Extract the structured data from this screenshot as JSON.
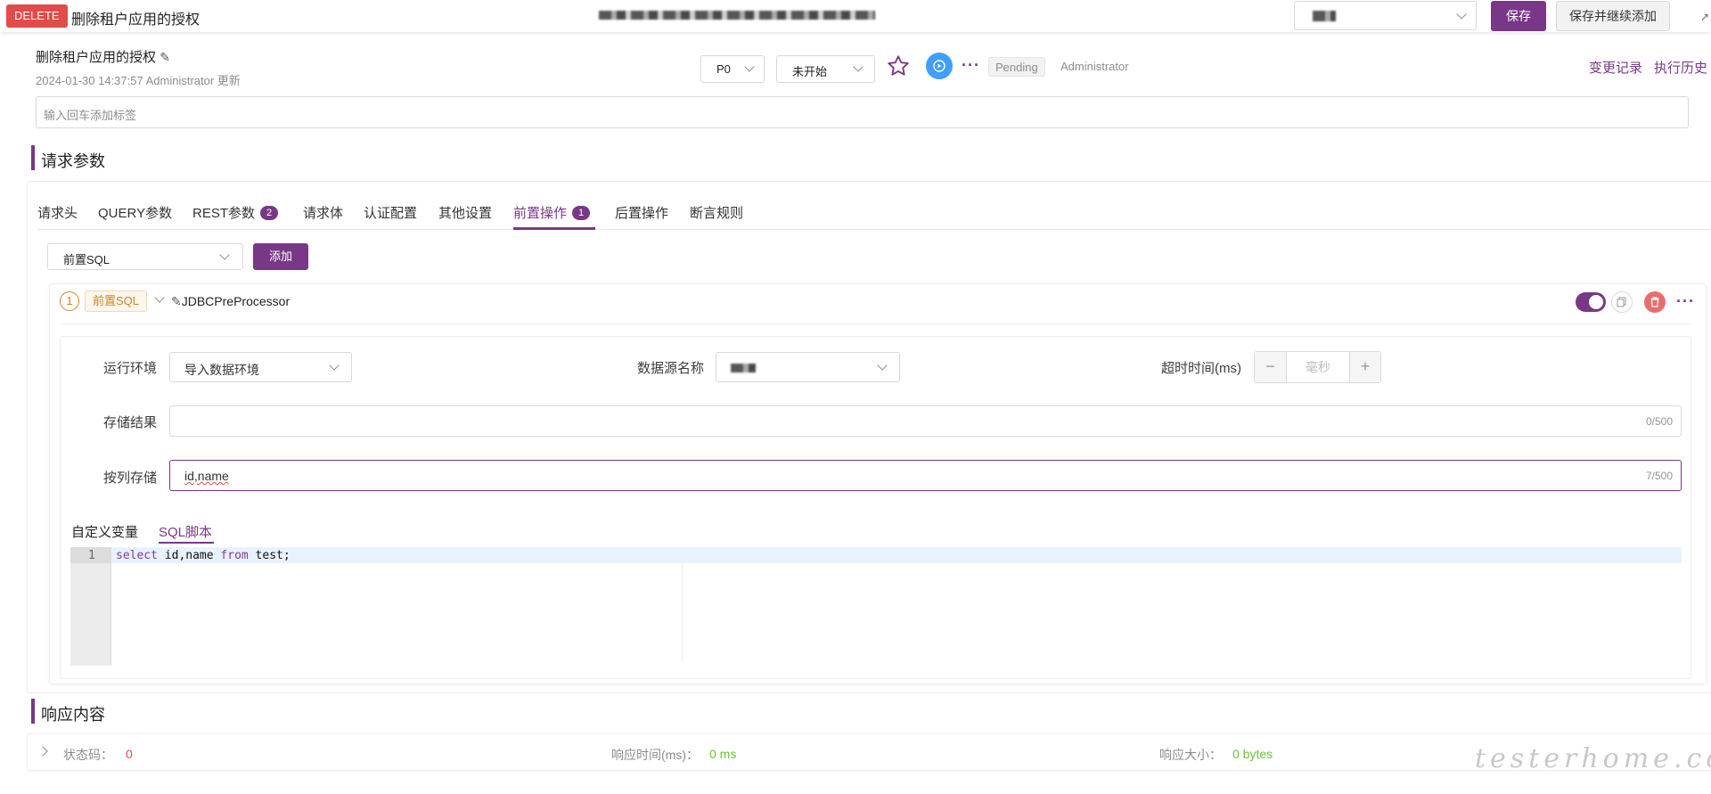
{
  "top": {
    "method": "DELETE",
    "title": "删除租户应用的授权",
    "save_label": "保存",
    "save_continue_label": "保存并继续添加"
  },
  "header": {
    "name": "删除租户应用的授权",
    "updated": "2024-01-30 14:37:57 Administrator 更新",
    "priority": "P0",
    "status": "未开始",
    "state_badge": "Pending",
    "user": "Administrator",
    "changelog_link": "变更记录",
    "history_link": "执行历史",
    "tag_placeholder": "输入回车添加标签"
  },
  "request": {
    "title": "请求参数",
    "tabs": [
      {
        "label": "请求头"
      },
      {
        "label": "QUERY参数"
      },
      {
        "label": "REST参数",
        "badge": "2"
      },
      {
        "label": "请求体"
      },
      {
        "label": "认证配置"
      },
      {
        "label": "其他设置"
      },
      {
        "label": "前置操作",
        "badge": "1"
      },
      {
        "label": "后置操作"
      },
      {
        "label": "断言规则"
      }
    ],
    "type_select": "前置SQL",
    "add_label": "添加"
  },
  "processor": {
    "index": "1",
    "type_tag": "前置SQL",
    "name": "JDBCPreProcessor",
    "env_label": "运行环境",
    "env_value": "导入数据环境",
    "datasource_label": "数据源名称",
    "timeout_label": "超时时间(ms)",
    "timeout_placeholder": "毫秒",
    "store_result_label": "存储结果",
    "store_result_count": "0/500",
    "store_by_column_label": "按列存储",
    "store_by_column_value": "id,name",
    "store_by_column_count": "7/500",
    "subtab_vars": "自定义变量",
    "subtab_sql": "SQL脚本",
    "editor_line": "1",
    "sql_kw1": "select",
    "sql_mid": " id,name ",
    "sql_kw2": "from",
    "sql_end": " test;"
  },
  "response": {
    "title": "响应内容",
    "status_label": "状态码：",
    "status_value": "0",
    "time_label": "响应时间(ms)：",
    "time_value": "0 ms",
    "size_label": "响应大小：",
    "size_value": "0 bytes"
  },
  "watermark": "testerhome.com",
  "colors": {
    "brand": "#783887",
    "danger": "#e34a4a",
    "success": "#67c23a",
    "link_blue": "#409eff"
  }
}
